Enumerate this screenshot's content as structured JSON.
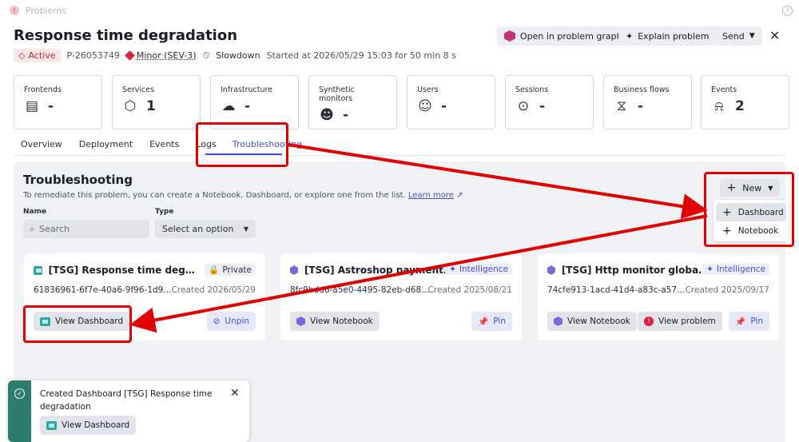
{
  "topbar": {
    "title": "Problems",
    "help": "?"
  },
  "header": {
    "title": "Response time degradation",
    "status": "Active",
    "problem_id": "P-26053749",
    "severity": "Minor (SEV-3)",
    "category": "Slowdown",
    "started": "Started at 2026/05/29 15:03 for 50 min 8 s",
    "buttons": {
      "graph": "Open in problem graph",
      "explain": "Explain problem",
      "send": "Send"
    }
  },
  "kpis": [
    {
      "label": "Frontends",
      "value": "-",
      "icon": "frontend-icon"
    },
    {
      "label": "Services",
      "value": "1",
      "icon": "services-icon"
    },
    {
      "label": "Infrastructure",
      "value": "-",
      "icon": "cloud-icon"
    },
    {
      "label": "Synthetic monitors",
      "value": "-",
      "icon": "robot-icon"
    },
    {
      "label": "Users",
      "value": "-",
      "icon": "users-icon"
    },
    {
      "label": "Sessions",
      "value": "-",
      "icon": "sessions-icon"
    },
    {
      "label": "Business flows",
      "value": "-",
      "icon": "flow-icon"
    },
    {
      "label": "Events",
      "value": "2",
      "icon": "alarm-icon"
    }
  ],
  "tabs": [
    "Overview",
    "Deployment",
    "Events",
    "Logs",
    "Troubleshooting"
  ],
  "troubleshooting": {
    "title": "Troubleshooting",
    "description": "To remediate this problem, you can create a Notebook, Dashboard, or explore one from the list.",
    "learn_more": "Learn more",
    "name_label": "Name",
    "type_label": "Type",
    "search_placeholder": "Search",
    "type_select": "Select an option",
    "new_button": "New",
    "menu": [
      "Dashboard",
      "Notebook"
    ]
  },
  "cards": [
    {
      "title": "[TSG] Response time degradation",
      "badge": "Private",
      "id": "61836961-6f7e-40a6-9f96-1d94c...",
      "created": "Created 2026/05/29",
      "primary": "View Dashboard",
      "secondary": "Unpin"
    },
    {
      "title": "[TSG] Astroshop payment se...",
      "badge": "Intelligence",
      "id": "8fc9bdd6-a5e0-4495-82eb-d68fdf...",
      "created": "Created 2025/08/21",
      "primary": "View Notebook",
      "secondary": "Pin"
    },
    {
      "title": "[TSG] Http monitor global ou...",
      "badge": "Intelligence",
      "id": "74cfe913-1acd-41d4-a83c-a57eb...",
      "created": "Created 2025/09/17",
      "primary": "View Notebook",
      "tertiary": "View problem",
      "secondary": "Pin"
    }
  ],
  "toast": {
    "message": "Created Dashboard [TSG] Response time degradation",
    "button": "View Dashboard"
  },
  "colors": {
    "accent": "#454fcf",
    "annotation": "#e30000",
    "toast_bar": "#2e7d6a"
  }
}
